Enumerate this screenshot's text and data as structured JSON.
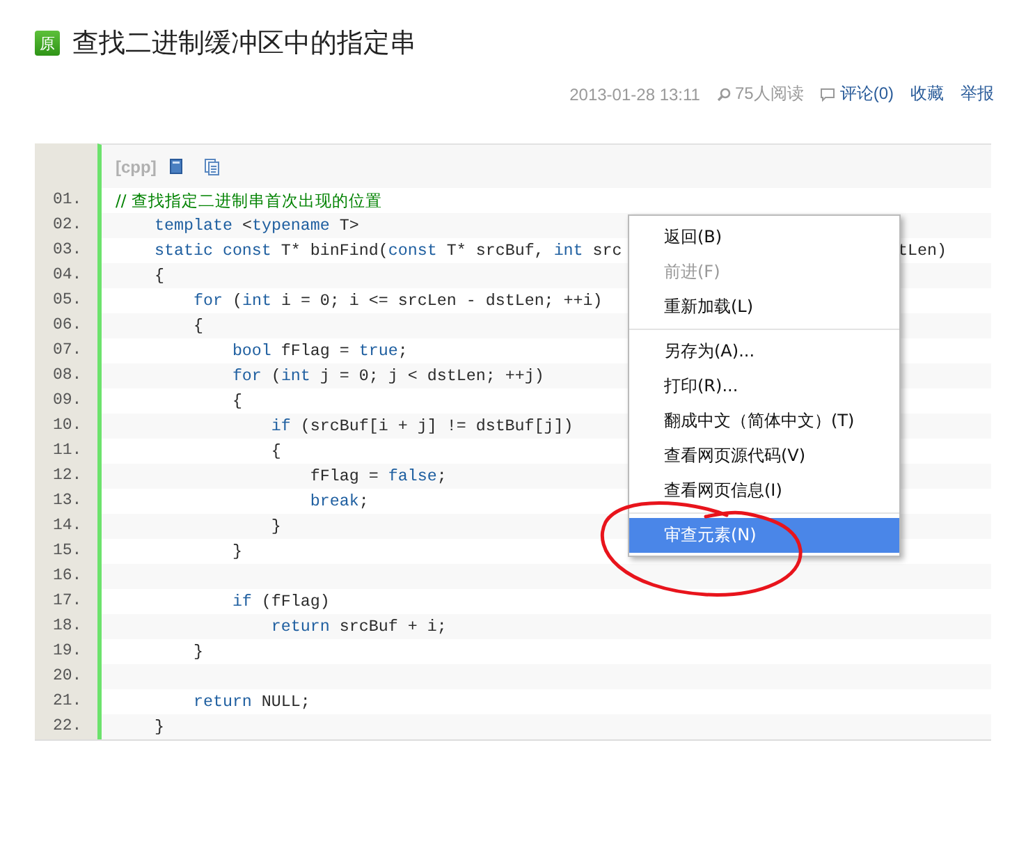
{
  "article": {
    "badge": "原",
    "title": "查找二进制缓冲区中的指定串"
  },
  "meta": {
    "date": "2013-01-28 13:11",
    "views": "75人阅读",
    "comments": "评论(0)",
    "favorite": "收藏",
    "report": "举报"
  },
  "code": {
    "language": "[cpp]",
    "lines": [
      {
        "number": "01.",
        "tokens": [
          {
            "text": "// 查找指定二进制串首次出现的位置",
            "kind": "comment"
          }
        ]
      },
      {
        "number": "02.",
        "tokens": [
          {
            "text": "    template",
            "kind": "keyword"
          },
          {
            "text": " <",
            "kind": "plain"
          },
          {
            "text": "typename",
            "kind": "keyword"
          },
          {
            "text": " T>",
            "kind": "plain"
          }
        ]
      },
      {
        "number": "03.",
        "tokens": [
          {
            "text": "    static const",
            "kind": "keyword"
          },
          {
            "text": " T* binFind(",
            "kind": "plain"
          },
          {
            "text": "const",
            "kind": "keyword"
          },
          {
            "text": " T* srcBuf, ",
            "kind": "plain"
          },
          {
            "text": "int",
            "kind": "keyword"
          },
          {
            "text": " src",
            "kind": "plain"
          }
        ],
        "tail": "tLen)"
      },
      {
        "number": "04.",
        "tokens": [
          {
            "text": "    {",
            "kind": "plain"
          }
        ]
      },
      {
        "number": "05.",
        "tokens": [
          {
            "text": "        for",
            "kind": "keyword"
          },
          {
            "text": " (",
            "kind": "plain"
          },
          {
            "text": "int",
            "kind": "keyword"
          },
          {
            "text": " i = 0; i <= srcLen - dstLen; ++i)",
            "kind": "plain"
          }
        ]
      },
      {
        "number": "06.",
        "tokens": [
          {
            "text": "        {",
            "kind": "plain"
          }
        ]
      },
      {
        "number": "07.",
        "tokens": [
          {
            "text": "            bool",
            "kind": "keyword"
          },
          {
            "text": " fFlag = ",
            "kind": "plain"
          },
          {
            "text": "true",
            "kind": "keyword"
          },
          {
            "text": ";",
            "kind": "plain"
          }
        ]
      },
      {
        "number": "08.",
        "tokens": [
          {
            "text": "            for",
            "kind": "keyword"
          },
          {
            "text": " (",
            "kind": "plain"
          },
          {
            "text": "int",
            "kind": "keyword"
          },
          {
            "text": " j = 0; j < dstLen; ++j)",
            "kind": "plain"
          }
        ]
      },
      {
        "number": "09.",
        "tokens": [
          {
            "text": "            {",
            "kind": "plain"
          }
        ]
      },
      {
        "number": "10.",
        "tokens": [
          {
            "text": "                if",
            "kind": "keyword"
          },
          {
            "text": " (srcBuf[i + j] != dstBuf[j])",
            "kind": "plain"
          }
        ]
      },
      {
        "number": "11.",
        "tokens": [
          {
            "text": "                {",
            "kind": "plain"
          }
        ]
      },
      {
        "number": "12.",
        "tokens": [
          {
            "text": "                    fFlag = ",
            "kind": "plain"
          },
          {
            "text": "false",
            "kind": "keyword"
          },
          {
            "text": ";",
            "kind": "plain"
          }
        ]
      },
      {
        "number": "13.",
        "tokens": [
          {
            "text": "                    break",
            "kind": "keyword"
          },
          {
            "text": ";",
            "kind": "plain"
          }
        ]
      },
      {
        "number": "14.",
        "tokens": [
          {
            "text": "                }",
            "kind": "plain"
          }
        ]
      },
      {
        "number": "15.",
        "tokens": [
          {
            "text": "            }",
            "kind": "plain"
          }
        ]
      },
      {
        "number": "16."
      },
      {
        "number": "17.",
        "tokens": [
          {
            "text": "            if",
            "kind": "keyword"
          },
          {
            "text": " (fFlag)",
            "kind": "plain"
          }
        ]
      },
      {
        "number": "18.",
        "tokens": [
          {
            "text": "                return",
            "kind": "keyword"
          },
          {
            "text": " srcBuf + i;",
            "kind": "plain"
          }
        ]
      },
      {
        "number": "19.",
        "tokens": [
          {
            "text": "        }",
            "kind": "plain"
          }
        ]
      },
      {
        "number": "20."
      },
      {
        "number": "21.",
        "tokens": [
          {
            "text": "        return",
            "kind": "keyword"
          },
          {
            "text": " NULL;",
            "kind": "plain"
          }
        ]
      },
      {
        "number": "22.",
        "tokens": [
          {
            "text": "    }",
            "kind": "plain"
          }
        ]
      }
    ]
  },
  "context_menu": {
    "groups": [
      [
        {
          "label": "返回(B)",
          "disabled": false,
          "selected": false
        },
        {
          "label": "前进(F)",
          "disabled": true,
          "selected": false
        },
        {
          "label": "重新加载(L)",
          "disabled": false,
          "selected": false
        }
      ],
      [
        {
          "label": "另存为(A)...",
          "disabled": false,
          "selected": false
        },
        {
          "label": "打印(R)...",
          "disabled": false,
          "selected": false
        },
        {
          "label": "翻成中文（简体中文）(T)",
          "disabled": false,
          "selected": false
        },
        {
          "label": "查看网页源代码(V)",
          "disabled": false,
          "selected": false
        },
        {
          "label": "查看网页信息(I)",
          "disabled": false,
          "selected": false
        }
      ],
      [
        {
          "label": "审查元素(N)",
          "disabled": false,
          "selected": true
        }
      ]
    ]
  }
}
